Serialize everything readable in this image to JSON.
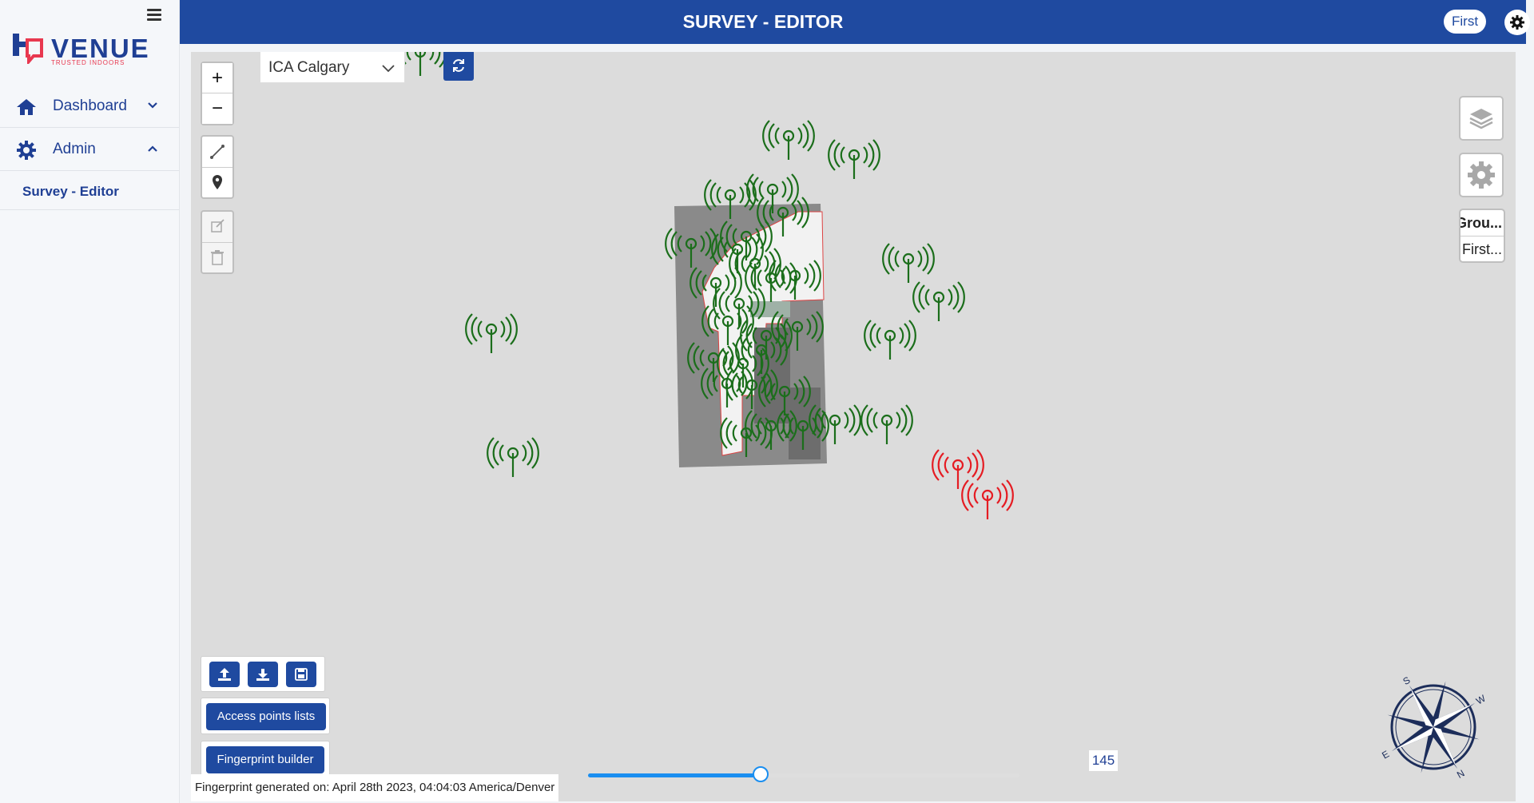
{
  "sidebar": {
    "brand": {
      "name": "VENUE",
      "tagline": "TRUSTED INDOORS"
    },
    "items": [
      {
        "label": "Dashboard",
        "icon": "home-icon",
        "chevron": "chevron-down-icon"
      },
      {
        "label": "Admin",
        "icon": "gear-icon",
        "chevron": "chevron-up-icon"
      }
    ],
    "subitems": [
      {
        "label": "Survey - Editor"
      }
    ]
  },
  "header": {
    "title": "SURVEY - EDITOR",
    "user_label": "First"
  },
  "map": {
    "venue_select": {
      "selected": "ICA Calgary"
    },
    "zoom_in_label": "+",
    "zoom_out_label": "−",
    "floor_panel": {
      "header": "Grou...",
      "value": "First..."
    },
    "buttons": {
      "access_points": "Access points lists",
      "fingerprint_builder": "Fingerprint builder"
    },
    "fingerprint_note": "Fingerprint generated on: April 28th 2023, 04:04:03 America/Denver",
    "slider": {
      "value": "145",
      "fraction": 0.4
    },
    "compass_letters": {
      "s": "S",
      "w": "W",
      "e": "E",
      "n": "N"
    }
  },
  "colors": {
    "brand_blue": "#1f4aa0",
    "ap_green": "#1b6e1b",
    "ap_red": "#e51c23",
    "slider_blue": "#1a8ef0"
  }
}
